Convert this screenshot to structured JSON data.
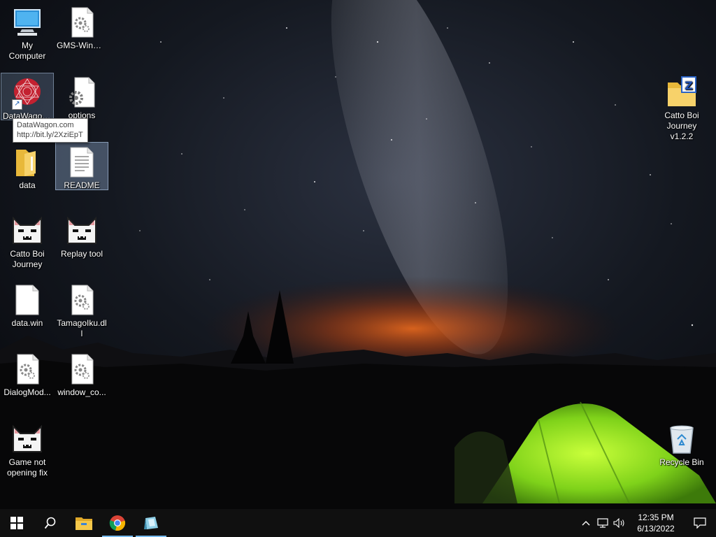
{
  "desktop": {
    "icons": [
      {
        "label": "My Computer",
        "icon": "computer-icon"
      },
      {
        "label": "GMS-WinDe...",
        "icon": "settings-file-icon"
      },
      {
        "label": "DataWagon...",
        "icon": "datawagon-shortcut-icon"
      },
      {
        "label": "options",
        "icon": "settings-file-icon"
      },
      {
        "label": "data",
        "icon": "folder-icon"
      },
      {
        "label": "README",
        "icon": "text-file-icon"
      },
      {
        "label": "Catto Boi Journey",
        "icon": "cat-icon"
      },
      {
        "label": "Replay tool",
        "icon": "cat-icon"
      },
      {
        "label": "data.win",
        "icon": "blank-file-icon"
      },
      {
        "label": "TamagoIku.dll",
        "icon": "settings-file-icon"
      },
      {
        "label": "DialogMod...",
        "icon": "settings-file-icon"
      },
      {
        "label": "window_co...",
        "icon": "settings-file-icon"
      },
      {
        "label": "Game not opening fix",
        "icon": "cat-icon"
      },
      {
        "label": "Catto Boi Journey v1.2.2",
        "icon": "zip-folder-icon"
      },
      {
        "label": "Recycle Bin",
        "icon": "recycle-bin-icon"
      }
    ],
    "tooltip": {
      "line1": "DataWagon.com",
      "line2": "http://bit.ly/2XziEpT"
    }
  },
  "taskbar": {
    "buttons": [
      {
        "icon": "windows-start-icon"
      },
      {
        "icon": "search-icon"
      },
      {
        "icon": "file-explorer-icon"
      },
      {
        "icon": "chrome-icon"
      },
      {
        "icon": "app-icon"
      }
    ],
    "tray": {
      "icons": [
        "chevron-up-icon",
        "network-icon",
        "volume-icon",
        "notification-icon"
      ],
      "time": "12:35 PM",
      "date": "6/13/2022"
    }
  }
}
